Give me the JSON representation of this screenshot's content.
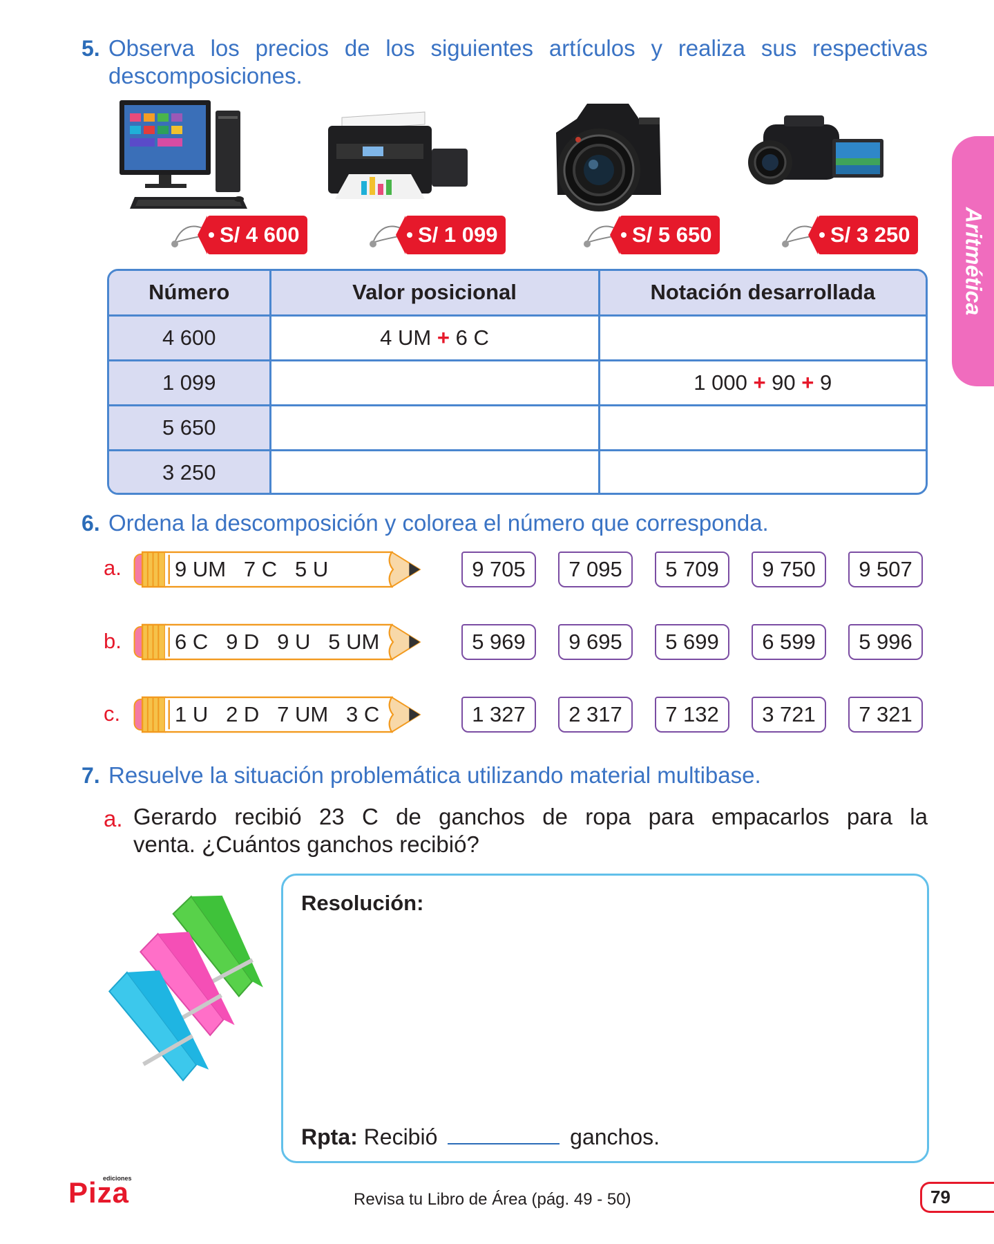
{
  "q5": {
    "number": "5.",
    "line1": "Observa los precios de los siguientes artículos y realiza sus respectivas",
    "line2": "descomposiciones.",
    "prices": [
      "S/ 4 600",
      "S/ 1 099",
      "S/ 5 650",
      "S/ 3 250"
    ],
    "products": [
      "computer-image",
      "printer-image",
      "camera-image",
      "camcorder-image"
    ]
  },
  "table": {
    "headers": [
      "Número",
      "Valor posicional",
      "Notación desarrollada"
    ],
    "rows": [
      {
        "numero": "4 600",
        "valor": [
          "4 UM",
          "6 C"
        ],
        "notacion": []
      },
      {
        "numero": "1 099",
        "valor": [],
        "notacion": [
          "1 000",
          "90",
          "9"
        ]
      },
      {
        "numero": "5 650",
        "valor": [],
        "notacion": []
      },
      {
        "numero": "3 250",
        "valor": [],
        "notacion": []
      }
    ],
    "plus": "+"
  },
  "q6": {
    "number": "6.",
    "text": "Ordena la descomposición y colorea el número que corresponda.",
    "rows": [
      {
        "letter": "a.",
        "pencil": "9 UM   7 C   5 U",
        "options": [
          "9 705",
          "7 095",
          "5 709",
          "9 750",
          "9 507"
        ]
      },
      {
        "letter": "b.",
        "pencil": "6 C   9 D   9 U   5 UM",
        "options": [
          "5 969",
          "9 695",
          "5 699",
          "6 599",
          "5 996"
        ]
      },
      {
        "letter": "c.",
        "pencil": "1 U   2 D   7 UM   3 C",
        "options": [
          "1 327",
          "2 317",
          "7 132",
          "3 721",
          "7 321"
        ]
      }
    ]
  },
  "q7": {
    "number": "7.",
    "text": "Resuelve la situación problemática utilizando material multibase.",
    "sub_letter": "a.",
    "sub_line1": "Gerardo recibió 23 C de ganchos de ropa para empacarlos para la",
    "sub_line2": "venta. ¿Cuántos ganchos recibió?",
    "resolution_title": "Resolución:",
    "rpta_label": "Rpta:",
    "rpta_before": "Recibió",
    "rpta_after": "ganchos."
  },
  "side_tab": "Aritmética",
  "footer": {
    "logo_small": "ediciones",
    "logo": "Piza",
    "text": "Revisa tu Libro de Área (pág. 49 - 50)",
    "page": "79"
  },
  "colors": {
    "blue_text": "#3a73c4",
    "red": "#e6192b",
    "purple": "#7b4da3",
    "pink_tab": "#f06cbe",
    "table_fill": "#d9dcf2"
  }
}
